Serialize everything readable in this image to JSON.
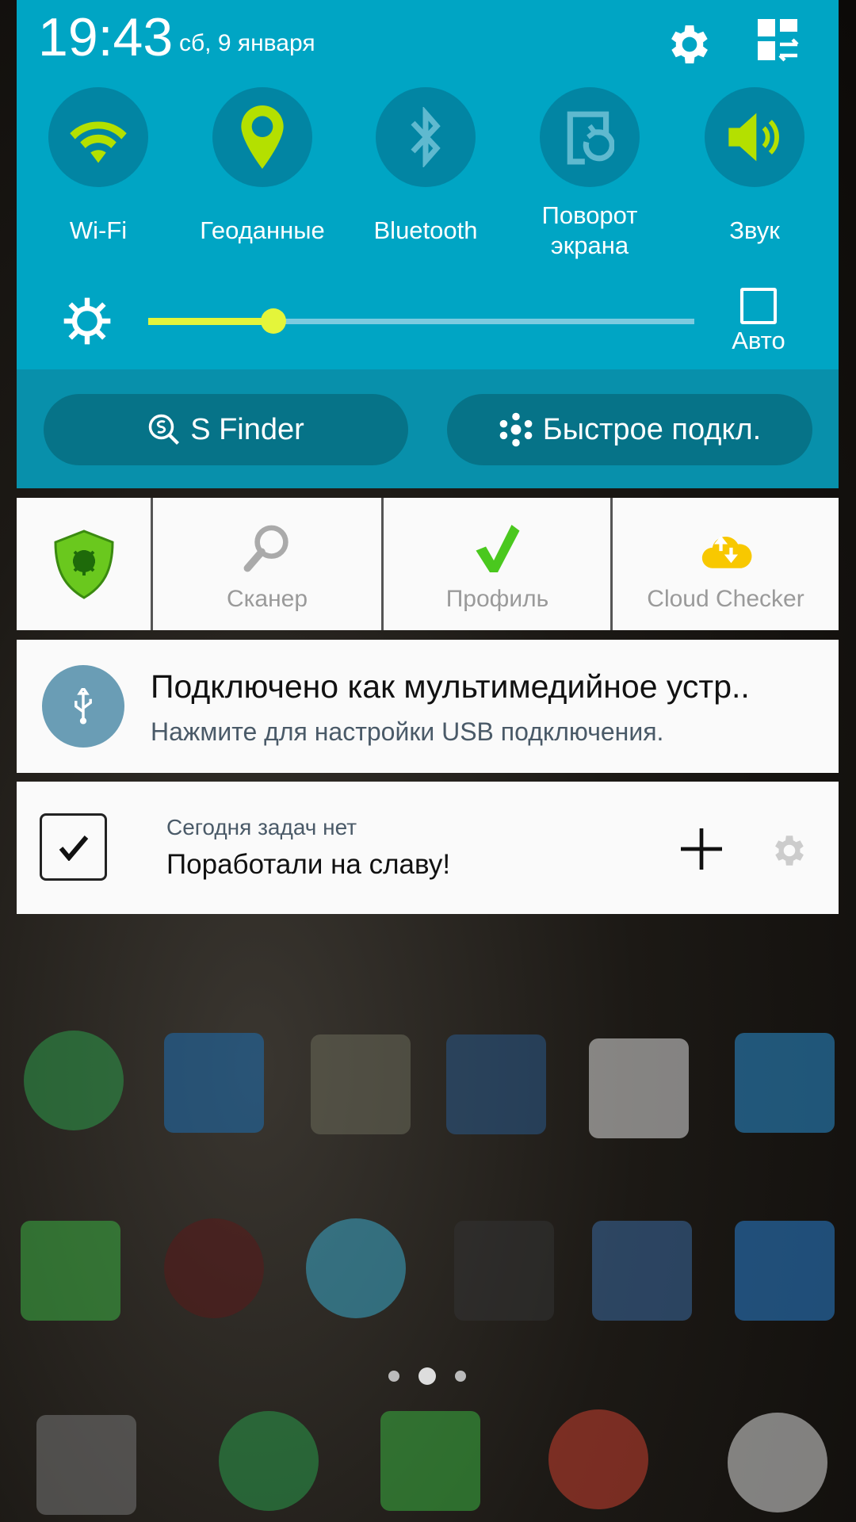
{
  "status": {
    "time": "19:43",
    "date": "сб, 9 января"
  },
  "header_icons": [
    "gear-icon",
    "edit-quick-settings-icon"
  ],
  "toggles": [
    {
      "label": "Wi-Fi",
      "icon": "wifi-icon",
      "active": true
    },
    {
      "label": "Геоданные",
      "icon": "location-icon",
      "active": true
    },
    {
      "label": "Bluetooth",
      "icon": "bluetooth-icon",
      "active": false
    },
    {
      "label": "Поворот",
      "label2": "экрана",
      "icon": "screen-rotation-icon",
      "active": false
    },
    {
      "label": "Звук",
      "icon": "sound-icon",
      "active": true
    }
  ],
  "brightness": {
    "level": 0.23,
    "auto_label": "Авто",
    "auto_checked": false
  },
  "buttons": {
    "sfinder": "S Finder",
    "quick_connect": "Быстрое подкл."
  },
  "drweb": {
    "items": [
      {
        "label": "Сканер"
      },
      {
        "label": "Профиль"
      },
      {
        "label": "Cloud Checker"
      }
    ]
  },
  "usb_notification": {
    "title": "Подключено как мультимедийное устр..",
    "subtitle": "Нажмите для настройки USB подключения."
  },
  "todo": {
    "subtitle": "Сегодня задач нет",
    "title": "Поработали на славу!"
  },
  "colors": {
    "panel": "#00a5c4",
    "panel_dark": "#0890ab",
    "active_icon": "#b4e000",
    "inactive_icon": "#5fb9cf"
  }
}
